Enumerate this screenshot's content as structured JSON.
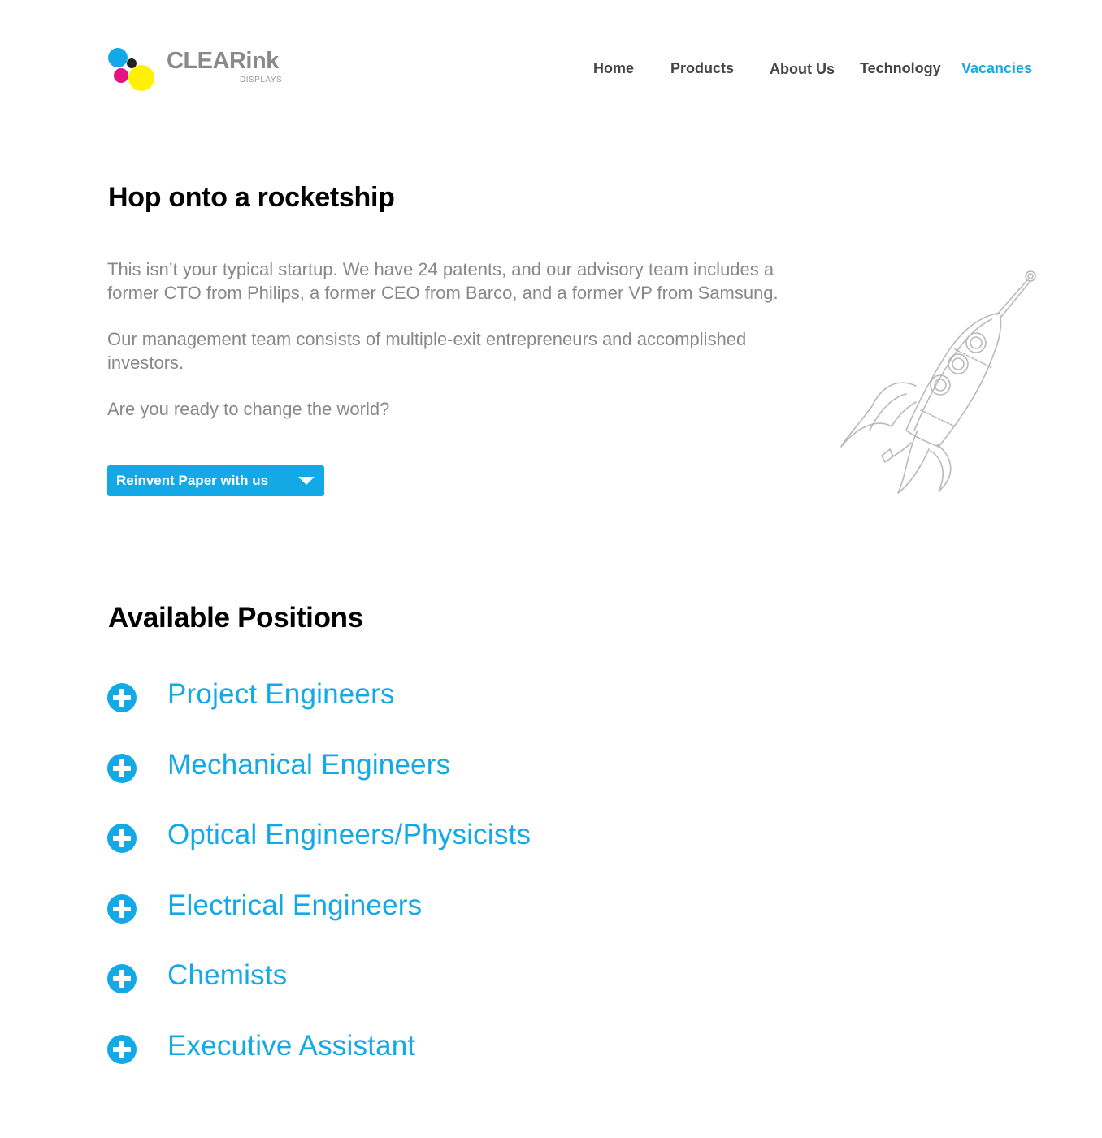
{
  "brand": {
    "name": "CLEARink",
    "subtitle": "DISPLAYS",
    "colors": {
      "cyan": "#13a9e6",
      "magenta": "#e6127f",
      "yellow": "#fff100",
      "black": "#222222",
      "gray": "#8a8a8a"
    }
  },
  "nav": {
    "items": [
      {
        "label": "Home",
        "active": false
      },
      {
        "label": "Products",
        "active": false
      },
      {
        "label": "About Us",
        "active": false
      },
      {
        "label": "Technology",
        "active": false
      },
      {
        "label": "Vacancies",
        "active": true
      }
    ]
  },
  "hero": {
    "title": "Hop onto a rocketship",
    "paragraphs": [
      "This isn’t your typical startup. We have 24 patents, and our advisory team includes a former CTO from Philips, a former CEO from Barco, and a former VP from Samsung.",
      "Our management team consists of multiple-exit entrepreneurs and accomplished investors.",
      "Are you ready to change the world?"
    ],
    "cta_label": "Reinvent Paper with us",
    "illustration": "rocket-illustration"
  },
  "positions": {
    "title": "Available Positions",
    "items": [
      {
        "label": "Project Engineers",
        "icon": "plus-circle-icon"
      },
      {
        "label": "Mechanical Engineers",
        "icon": "plus-circle-icon"
      },
      {
        "label": "Optical Engineers/Physicists",
        "icon": "plus-circle-icon"
      },
      {
        "label": "Electrical Engineers",
        "icon": "plus-circle-icon"
      },
      {
        "label": "Chemists",
        "icon": "plus-circle-icon"
      },
      {
        "label": "Executive Assistant",
        "icon": "plus-circle-icon"
      }
    ]
  }
}
